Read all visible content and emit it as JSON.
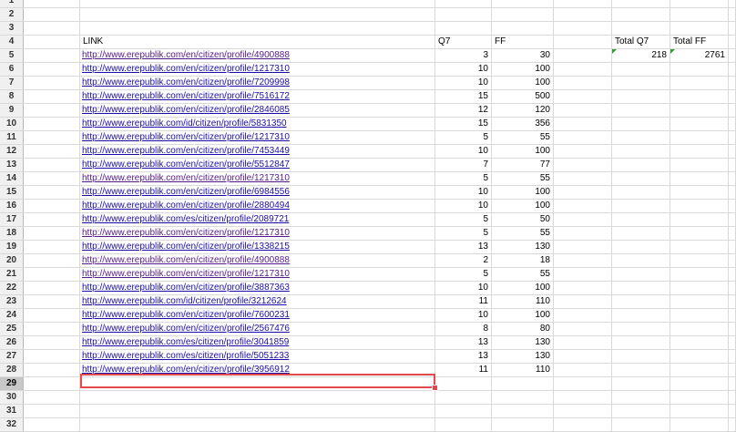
{
  "row_numbers": [
    "1",
    "2",
    "3",
    "4",
    "5",
    "6",
    "7",
    "8",
    "9",
    "10",
    "11",
    "12",
    "13",
    "14",
    "15",
    "16",
    "17",
    "18",
    "19",
    "20",
    "21",
    "22",
    "23",
    "24",
    "25",
    "26",
    "27",
    "28",
    "29",
    "30",
    "31",
    "32"
  ],
  "selected_row": "29",
  "headers": {
    "link": "LINK",
    "q7": "Q7",
    "ff": "FF",
    "total_q7": "Total Q7",
    "total_ff": "Total FF"
  },
  "totals": {
    "q7": "218",
    "ff": "2761"
  },
  "rows": [
    {
      "link": "http://www.erepublik.com/en/citizen/profile/4900888",
      "visited": true,
      "q7": "3",
      "ff": "30"
    },
    {
      "link": "http://www.erepublik.com/en/citizen/profile/1217310",
      "visited": false,
      "q7": "10",
      "ff": "100"
    },
    {
      "link": "http://www.erepublik.com/en/citizen/profile/7209998",
      "visited": false,
      "q7": "10",
      "ff": "100"
    },
    {
      "link": "http://www.erepublik.com/en/citizen/profile/7516172",
      "visited": false,
      "q7": "15",
      "ff": "500"
    },
    {
      "link": "http://www.erepublik.com/en/citizen/profile/2846085",
      "visited": false,
      "q7": "12",
      "ff": "120"
    },
    {
      "link": "http://www.erepublik.com/id/citizen/profile/5831350",
      "visited": false,
      "q7": "15",
      "ff": "356"
    },
    {
      "link": "http://www.erepublik.com/en/citizen/profile/1217310",
      "visited": false,
      "q7": "5",
      "ff": "55"
    },
    {
      "link": "http://www.erepublik.com/en/citizen/profile/7453449",
      "visited": false,
      "q7": "10",
      "ff": "100"
    },
    {
      "link": "http://www.erepublik.com/en/citizen/profile/5512847",
      "visited": false,
      "q7": "7",
      "ff": "77"
    },
    {
      "link": "http://www.erepublik.com/en/citizen/profile/1217310",
      "visited": true,
      "q7": "5",
      "ff": "55"
    },
    {
      "link": "http://www.erepublik.com/en/citizen/profile/6984556",
      "visited": false,
      "q7": "10",
      "ff": "100"
    },
    {
      "link": "http://www.erepublik.com/en/citizen/profile/2880494",
      "visited": false,
      "q7": "10",
      "ff": "100"
    },
    {
      "link": "http://www.erepublik.com/es/citizen/profile/2089721",
      "visited": false,
      "q7": "5",
      "ff": "50"
    },
    {
      "link": "http://www.erepublik.com/en/citizen/profile/1217310",
      "visited": true,
      "q7": "5",
      "ff": "55"
    },
    {
      "link": "http://www.erepublik.com/en/citizen/profile/1338215",
      "visited": false,
      "q7": "13",
      "ff": "130"
    },
    {
      "link": "http://www.erepublik.com/en/citizen/profile/4900888",
      "visited": true,
      "q7": "2",
      "ff": "18"
    },
    {
      "link": "http://www.erepublik.com/en/citizen/profile/1217310",
      "visited": true,
      "q7": "5",
      "ff": "55"
    },
    {
      "link": "http://www.erepublik.com/en/citizen/profile/3887363",
      "visited": false,
      "q7": "10",
      "ff": "100"
    },
    {
      "link": "http://www.erepublik.com/id/citizen/profile/3212624",
      "visited": false,
      "q7": "11",
      "ff": "110"
    },
    {
      "link": "http://www.erepublik.com/en/citizen/profile/7600231",
      "visited": false,
      "q7": "10",
      "ff": "100"
    },
    {
      "link": "http://www.erepublik.com/en/citizen/profile/2567476",
      "visited": false,
      "q7": "8",
      "ff": "80"
    },
    {
      "link": "http://www.erepublik.com/es/citizen/profile/3041859",
      "visited": false,
      "q7": "13",
      "ff": "130"
    },
    {
      "link": "http://www.erepublik.com/es/citizen/profile/5051233",
      "visited": false,
      "q7": "13",
      "ff": "130"
    },
    {
      "link": "http://www.erepublik.com/en/citizen/profile/3956912",
      "visited": false,
      "q7": "11",
      "ff": "110"
    }
  ]
}
